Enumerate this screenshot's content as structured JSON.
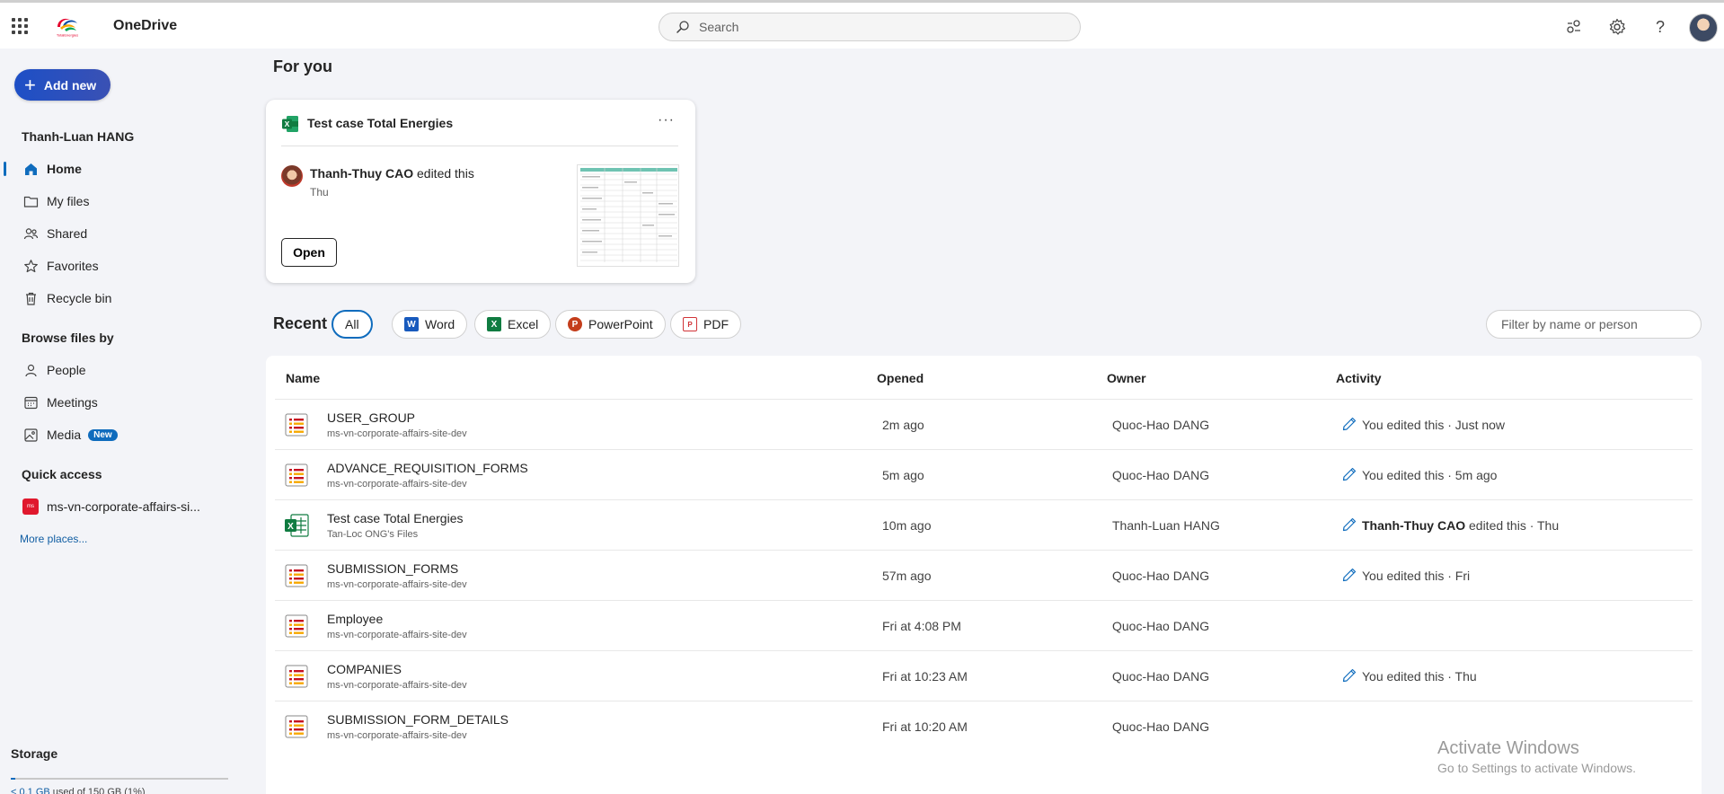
{
  "app": {
    "title": "OneDrive"
  },
  "search": {
    "placeholder": "Search"
  },
  "sidebar": {
    "add_new": "Add new",
    "user_name": "Thanh-Luan HANG",
    "nav": [
      {
        "label": "Home"
      },
      {
        "label": "My files"
      },
      {
        "label": "Shared"
      },
      {
        "label": "Favorites"
      },
      {
        "label": "Recycle bin"
      }
    ],
    "browse_heading": "Browse files by",
    "browse": [
      {
        "label": "People"
      },
      {
        "label": "Meetings"
      },
      {
        "label": "Media",
        "badge": "New"
      }
    ],
    "quick_access_heading": "Quick access",
    "quick_access": [
      {
        "label": "ms-vn-corporate-affairs-si..."
      }
    ],
    "more_places": "More places...",
    "storage": {
      "heading": "Storage",
      "used": "< 0.1 GB",
      "rest": " used of 150 GB (1%)",
      "percent": 1
    }
  },
  "for_you": {
    "heading": "For you",
    "card": {
      "title": "Test case Total Energies",
      "person": "Thanh-Thuy CAO",
      "action": " edited this",
      "time": "Thu",
      "open_label": "Open",
      "more": "···"
    }
  },
  "recent": {
    "heading": "Recent",
    "filters": [
      "All",
      "Word",
      "Excel",
      "PowerPoint",
      "PDF"
    ],
    "filter_placeholder": "Filter by name or person",
    "columns": [
      "Name",
      "Opened",
      "Owner",
      "Activity"
    ],
    "rows": [
      {
        "name": "USER_GROUP",
        "location": "ms-vn-corporate-affairs-site-dev",
        "opened": "2m ago",
        "owner": "Quoc-Hao DANG",
        "activity_person": "",
        "activity": "You edited this · Just now",
        "type": "list"
      },
      {
        "name": "ADVANCE_REQUISITION_FORMS",
        "location": "ms-vn-corporate-affairs-site-dev",
        "opened": "5m ago",
        "owner": "Quoc-Hao DANG",
        "activity_person": "",
        "activity": "You edited this · 5m ago",
        "type": "list"
      },
      {
        "name": "Test case Total Energies",
        "location": "Tan-Loc ONG's Files",
        "opened": "10m ago",
        "owner": "Thanh-Luan HANG",
        "activity_person": "Thanh-Thuy CAO",
        "activity": " edited this · Thu",
        "type": "excel"
      },
      {
        "name": "SUBMISSION_FORMS",
        "location": "ms-vn-corporate-affairs-site-dev",
        "opened": "57m ago",
        "owner": "Quoc-Hao DANG",
        "activity_person": "",
        "activity": "You edited this · Fri",
        "type": "list"
      },
      {
        "name": "Employee",
        "location": "ms-vn-corporate-affairs-site-dev",
        "opened": "Fri at 4:08 PM",
        "owner": "Quoc-Hao DANG",
        "activity_person": "",
        "activity": "",
        "type": "list"
      },
      {
        "name": "COMPANIES",
        "location": "ms-vn-corporate-affairs-site-dev",
        "opened": "Fri at 10:23 AM",
        "owner": "Quoc-Hao DANG",
        "activity_person": "",
        "activity": "You edited this · Thu",
        "type": "list"
      },
      {
        "name": "SUBMISSION_FORM_DETAILS",
        "location": "ms-vn-corporate-affairs-site-dev",
        "opened": "Fri at 10:20 AM",
        "owner": "Quoc-Hao DANG",
        "activity_person": "",
        "activity": "",
        "type": "list"
      }
    ]
  },
  "watermark": {
    "line1": "Activate Windows",
    "line2": "Go to Settings to activate Windows."
  },
  "colors": {
    "accent": "#0f6cbd",
    "add_new": "#2b50c0",
    "excel": "#107c41",
    "word": "#185abd",
    "powerpoint": "#c43e1c",
    "pdf": "#d13438",
    "list_red": "#c50f1f",
    "list_yellow": "#f7a800"
  }
}
